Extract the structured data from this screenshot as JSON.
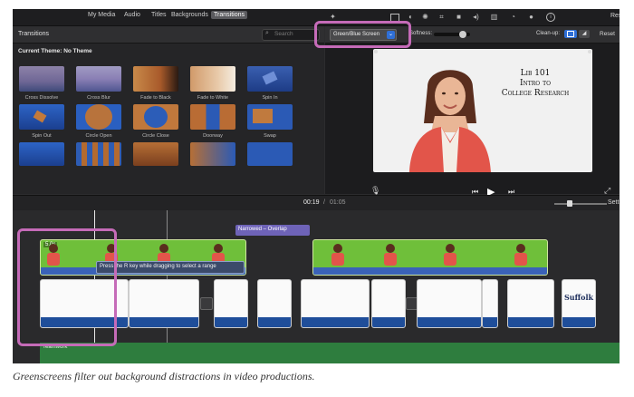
{
  "top_tabs": [
    "My Media",
    "Audio",
    "Titles",
    "Backgrounds",
    "Transitions"
  ],
  "active_tab": "Transitions",
  "browser": {
    "title": "Transitions",
    "search_placeholder": "Search",
    "theme_label": "Current Theme: No Theme",
    "tiles_row1": [
      "Cross Dissolve",
      "Cross Blur",
      "Fade to Black",
      "Fade to White",
      "Spin In"
    ],
    "tiles_row2": [
      "Spin Out",
      "Circle Open",
      "Circle Close",
      "Doorway",
      "Swap"
    ]
  },
  "viewer": {
    "overlay_dropdown": "Green/Blue Screen",
    "softness_label": "Softness:",
    "cleanup_label": "Clean-up:",
    "reset_label": "Reset",
    "video_text_line1": "Lib 101",
    "video_text_line2": "Intro to",
    "video_text_line3": "College Research"
  },
  "timeline": {
    "current_time": "00:19",
    "separator": "/",
    "total_time": "01:05",
    "settings_label": "Sett",
    "overlap_label": "Narrowed – Overlap",
    "clip_label": "5.0s",
    "tooltip": "Press the R key while dragging to select a range",
    "logo_text": "Suffolk",
    "music_label": "Teamwork"
  },
  "caption": "Greenscreens filter out background distractions in video productions.",
  "colors": {
    "accent_blue": "#2f6fd6",
    "green_clip": "#6fbf3a",
    "highlight": "#c56bb8",
    "overlap_bar": "#6e63b8",
    "music_track": "#2e7d3e"
  }
}
